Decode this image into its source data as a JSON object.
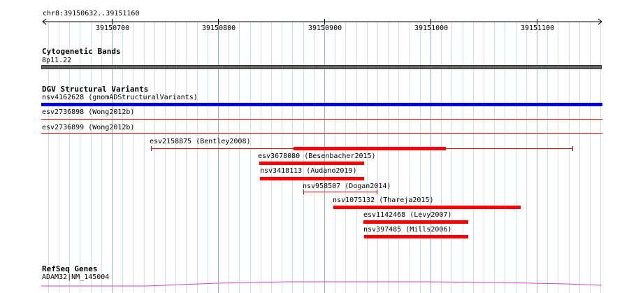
{
  "browser": {
    "location": "chr8:39150632..39151160",
    "ruler_ticks": [
      "39150700",
      "39150800",
      "39150900",
      "39151000",
      "39151100"
    ],
    "colors": {
      "grid_minor": "#cfe0ee",
      "grid_major": "#90b4d2",
      "ruler": "#000000"
    }
  },
  "tracks": {
    "cytoband": {
      "title": "Cytogenetic Bands",
      "band_label": "8p11.22",
      "color": "#666666"
    },
    "dgv": {
      "title": "DGV Structural Variants",
      "features": [
        {
          "label": "nsv4162628 (gnomADStructuralVariants)",
          "color": "#0000dd",
          "style": "blue-bar"
        },
        {
          "label": "esv2736898 (Wong2012b)",
          "color": "#ff0000",
          "style": "thin-line"
        },
        {
          "label": "esv2736899 (Wong2012b)",
          "color": "#ff0000",
          "style": "thin-line"
        },
        {
          "label": "esv2158875 (Bentley2008)",
          "color": "#ff0000",
          "style": "dumbbell-thick"
        },
        {
          "label": "esv3678080 (Besenbacher2015)",
          "color": "#ff0000",
          "style": "thick"
        },
        {
          "label": "nsv3418113 (Audano2019)",
          "color": "#ff0000",
          "style": "thick"
        },
        {
          "label": "nsv958507 (Dogan2014)",
          "color": "#ff0000",
          "style": "dumbbell"
        },
        {
          "label": "nsv1075132 (Thareja2015)",
          "color": "#ff0000",
          "style": "thick"
        },
        {
          "label": "esv1142468 (Levy2007)",
          "color": "#ff0000",
          "style": "thick"
        },
        {
          "label": "nsv397485 (Mills2006)",
          "color": "#ff0000",
          "style": "thick"
        }
      ]
    },
    "refseq": {
      "title": "RefSeq Genes",
      "gene_label": "ADAM32|NM_145004",
      "color": "#cc44cc"
    }
  }
}
